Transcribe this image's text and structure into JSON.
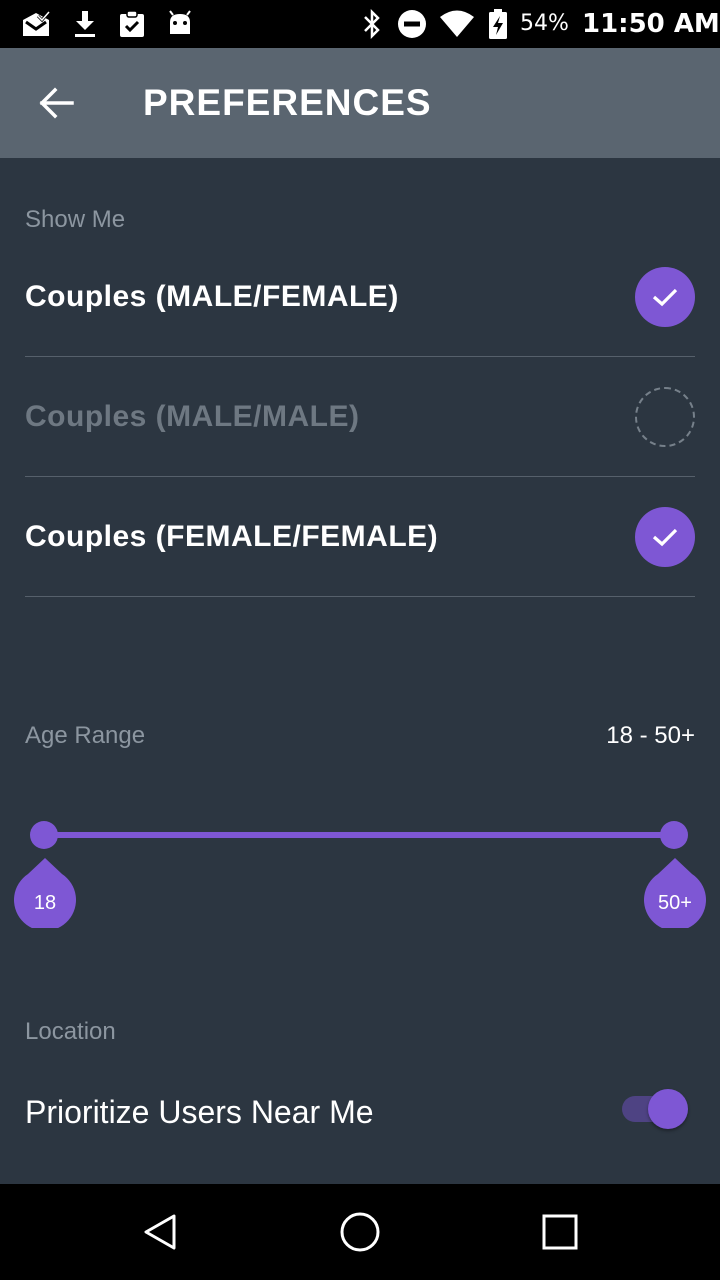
{
  "status_bar": {
    "battery": "54%",
    "time": "11:50 AM",
    "left_icons": [
      "mail-check-icon",
      "download-icon",
      "clipboard-check-icon",
      "android-icon"
    ],
    "right_icons": [
      "bluetooth-icon",
      "do-not-disturb-icon",
      "wifi-icon",
      "battery-charging-icon"
    ]
  },
  "header": {
    "title": "PREFERENCES",
    "back_icon": "arrow-left-icon"
  },
  "show_me": {
    "label": "Show Me",
    "options": [
      {
        "label": "Couples (MALE/FEMALE)",
        "selected": true
      },
      {
        "label": "Couples (MALE/MALE)",
        "selected": false
      },
      {
        "label": "Couples (FEMALE/FEMALE)",
        "selected": true
      }
    ]
  },
  "age_range": {
    "label": "Age Range",
    "value": "18 - 50+",
    "min_label": "18",
    "max_label": "50+"
  },
  "location": {
    "label": "Location",
    "toggle_label": "Prioritize Users Near Me",
    "enabled": true
  },
  "colors": {
    "accent": "#7e57d4",
    "background": "#2c3641",
    "app_bar": "#5a6570",
    "muted_text": "#8c96a0"
  },
  "nav_bar": {
    "icons": [
      "back-triangle-icon",
      "home-circle-icon",
      "recents-square-icon"
    ]
  }
}
